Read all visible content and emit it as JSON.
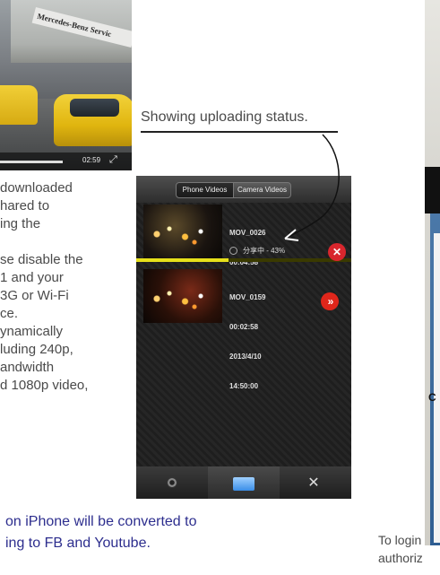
{
  "video": {
    "sign_text": "Mercedes-Benz Servic",
    "time": "02:59",
    "expand_icon": "expand-icon"
  },
  "left_text": {
    "lines": [
      "downloaded",
      "hared to",
      "ing the",
      "",
      "se disable the",
      "1 and your",
      "3G or Wi-Fi",
      "ce.",
      "ynamically",
      "luding 240p,",
      "andwidth",
      "d 1080p video,"
    ]
  },
  "annotation": {
    "text": "Showing uploading status."
  },
  "phone": {
    "tabs": {
      "phone_videos": "Phone Videos",
      "camera_videos": "Camera Videos"
    },
    "items": [
      {
        "name": "MOV_0026",
        "duration": "00:04:58",
        "status": "分享中 - 43%",
        "progress": 0.43,
        "action_icon": "cancel-icon"
      },
      {
        "name": "MOV_0159",
        "duration": "00:02:58",
        "date": "2013/4/10",
        "time": "14:50:00",
        "action_icon": "upload-icon"
      }
    ],
    "bottom_bar": [
      "camera-icon",
      "folder-icon",
      "settings-icon"
    ],
    "progress_color": "#e6e01a",
    "button_color": "#d8262d"
  },
  "footer": {
    "line1": "on iPhone will be converted to",
    "line2": "ing to FB and Youtube.",
    "color": "#2d2e8e"
  },
  "right_panel": {
    "letter": "C",
    "caption_line1": "To login",
    "caption_line2": "authoriz"
  }
}
